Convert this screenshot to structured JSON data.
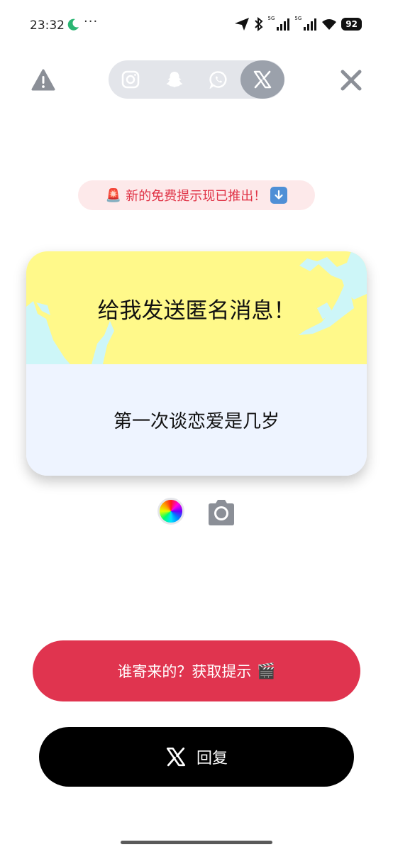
{
  "status_bar": {
    "time": "23:32",
    "more": "···",
    "battery": "92",
    "net1": "5G",
    "net2": "5G"
  },
  "top_bar": {
    "icons": [
      "warning-icon",
      "instagram-icon",
      "snapchat-icon",
      "whatsapp-icon",
      "x-icon",
      "close-icon"
    ],
    "active_platform": "X"
  },
  "banner": {
    "text": "新的免费提示现已推出！"
  },
  "card": {
    "title": "给我发送匿名消息！",
    "question": "第一次谈恋爱是几岁",
    "top_color": "#fff98a",
    "bottom_color": "#eef4ff",
    "splash_color": "#cdf6f8"
  },
  "buttons": {
    "hint": "谁寄来的？获取提示",
    "hint_color": "#e0344f",
    "reply": "回复",
    "reply_color": "#000000"
  }
}
